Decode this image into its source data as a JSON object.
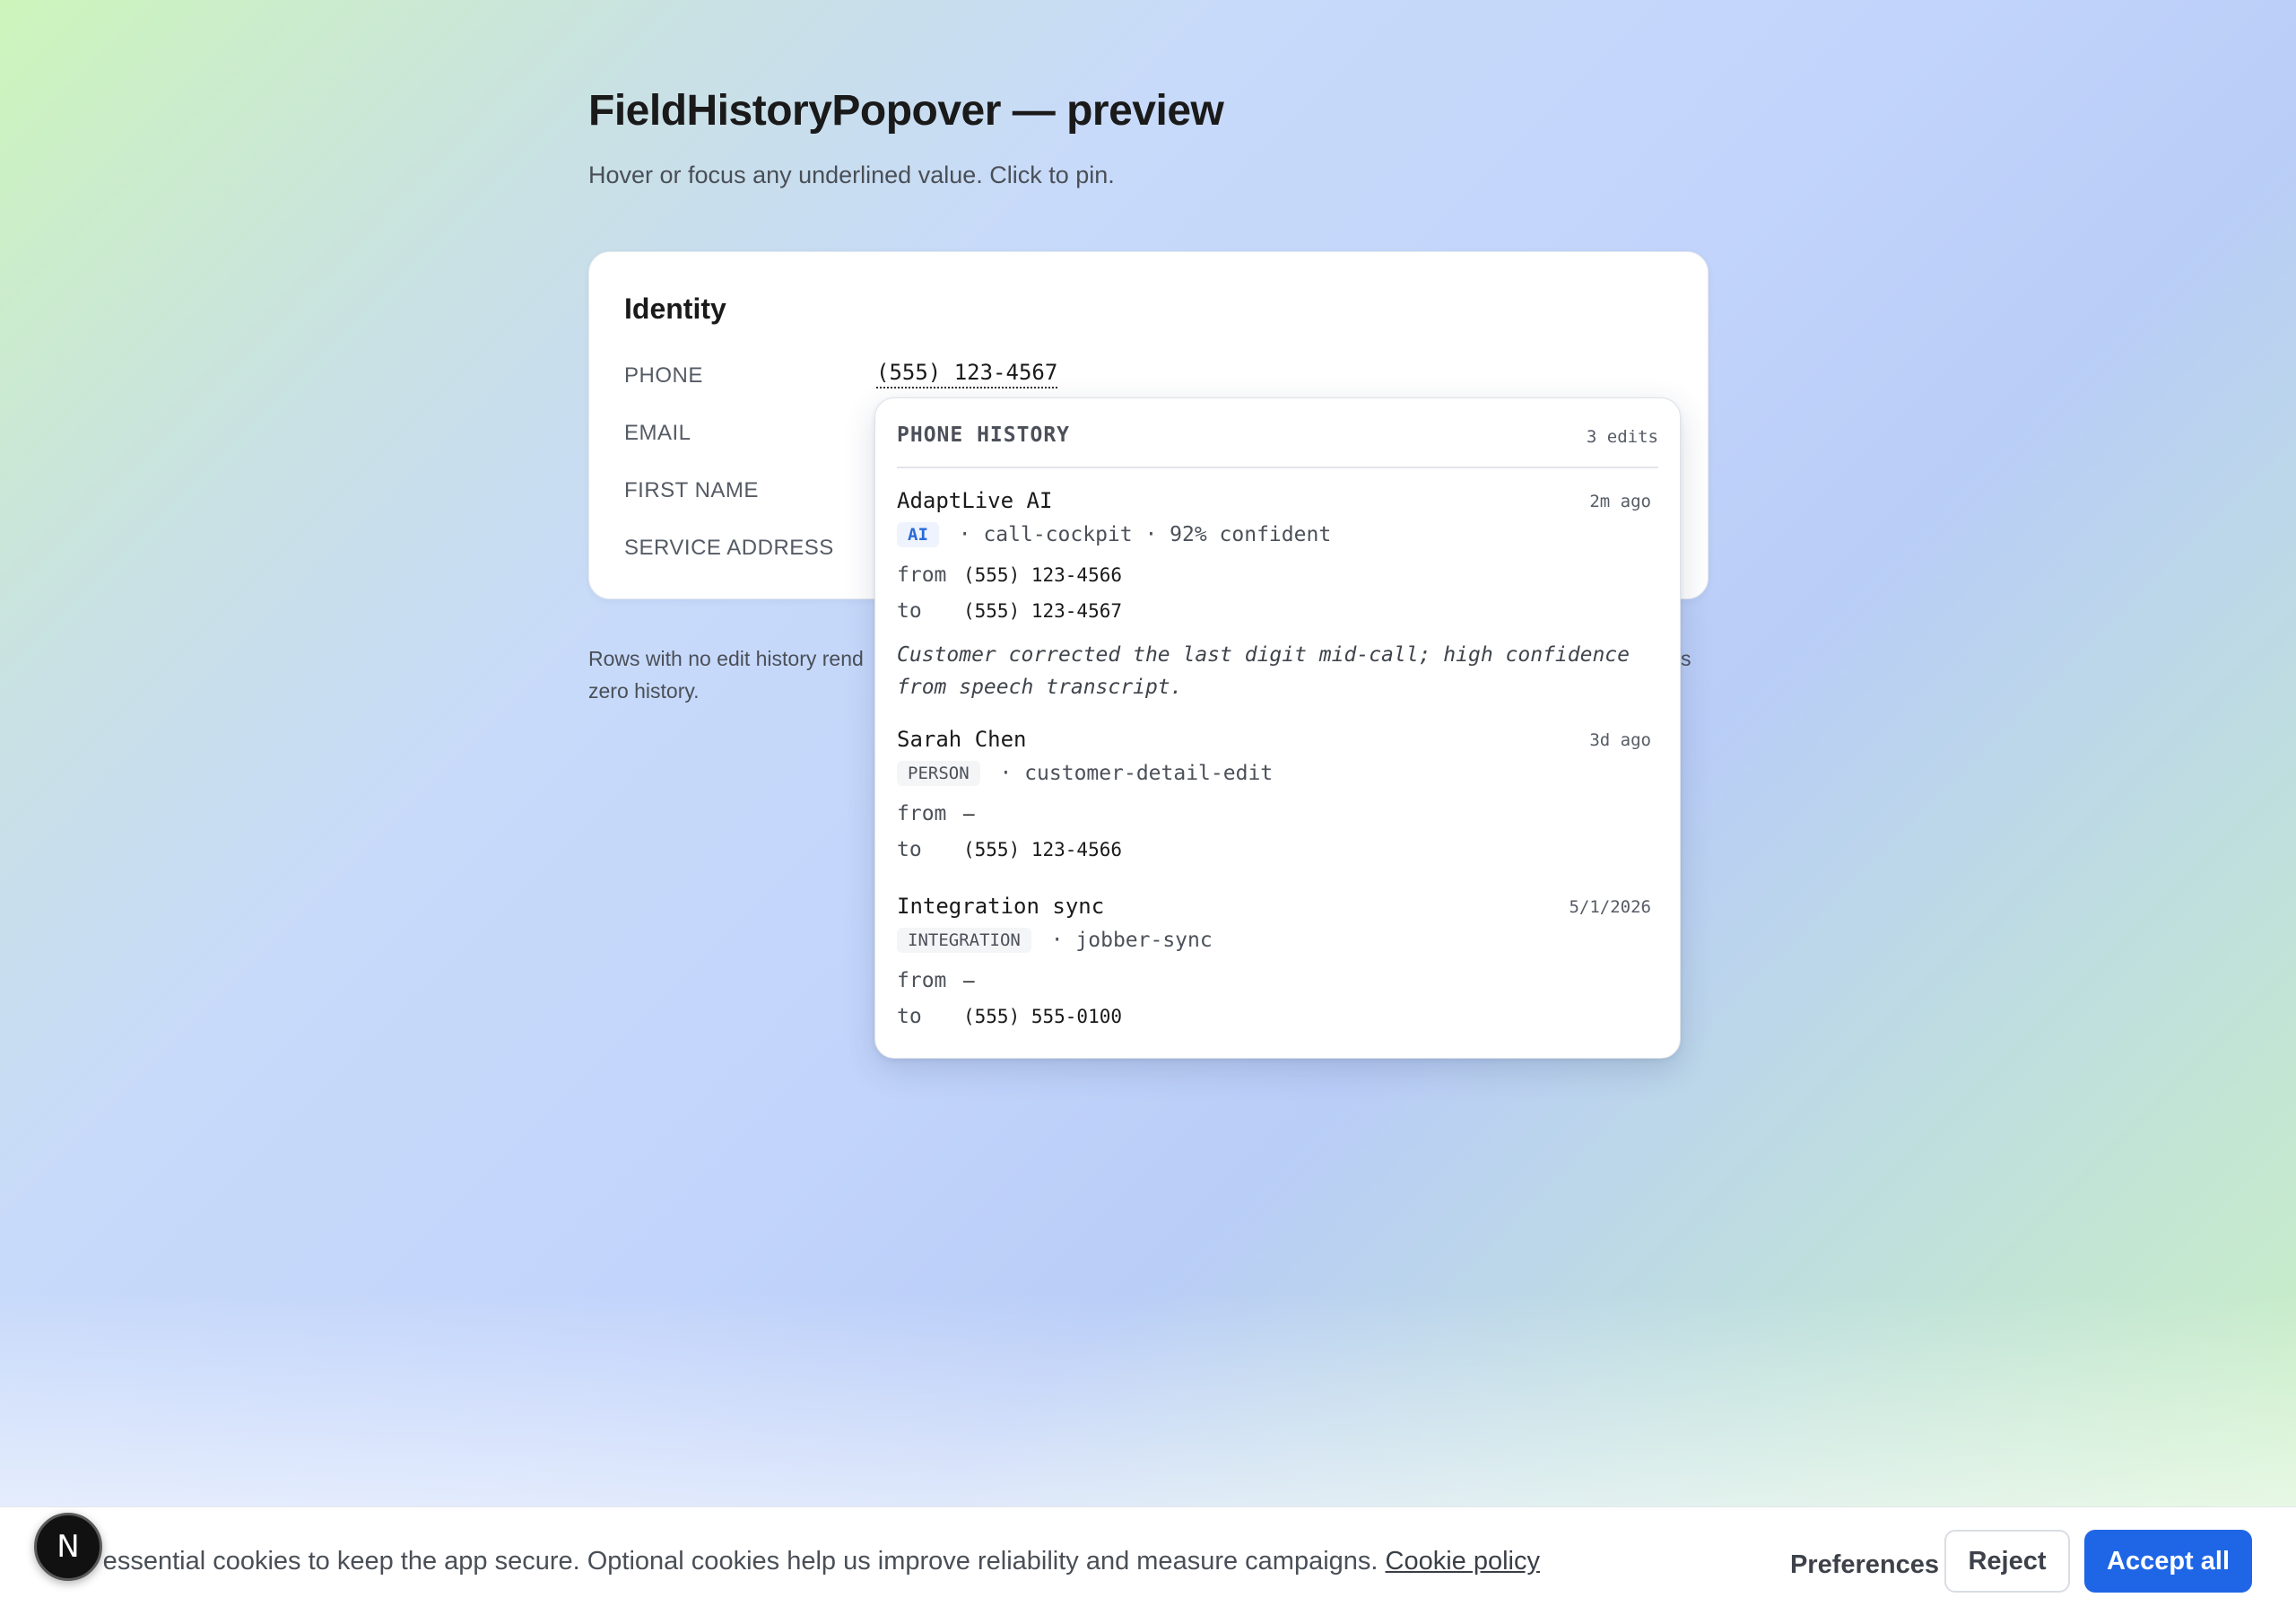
{
  "page": {
    "title": "FieldHistoryPopover — preview",
    "subtitle": "Hover or focus any underlined value. Click to pin."
  },
  "identity_card": {
    "title": "Identity",
    "fields": [
      {
        "label": "PHONE",
        "value": "(555) 123-4567"
      },
      {
        "label": "EMAIL"
      },
      {
        "label": "FIRST NAME"
      },
      {
        "label": "SERVICE ADDRESS"
      }
    ]
  },
  "note": {
    "left": "Rows with no edit history rend",
    "right": "s",
    "line2": "zero history."
  },
  "popover": {
    "title": "PHONE HISTORY",
    "count": "3 edits",
    "entries": [
      {
        "actor": "AdaptLive AI",
        "time": "2m ago",
        "tag": "AI",
        "meta": "· call-cockpit · 92% confident",
        "from_label": "from",
        "from": "(555) 123-4566",
        "to_label": "to",
        "to": "(555) 123-4567",
        "note": "Customer corrected the last digit mid-call; high confidence from speech transcript."
      },
      {
        "actor": "Sarah Chen",
        "time": "3d ago",
        "tag": "PERSON",
        "meta": "· customer-detail-edit",
        "from_label": "from",
        "from": "—",
        "to_label": "to",
        "to": "(555) 123-4566"
      },
      {
        "actor": "Integration sync",
        "time": "5/1/2026",
        "tag": "INTEGRATION",
        "meta": "· jobber-sync",
        "from_label": "from",
        "from": "—",
        "to_label": "to",
        "to": "(555) 555-0100"
      }
    ]
  },
  "cookie_banner": {
    "text": "se essential cookies to keep the app secure. Optional cookies help us improve reliability and measure campaigns.",
    "link": "Cookie policy",
    "preferences": "Preferences",
    "reject": "Reject",
    "accept": "Accept all"
  },
  "dev_badge": {
    "label": "N",
    "icon": "nextjs-logo-icon"
  },
  "colors": {
    "accent": "#1f66e6",
    "ai_tag": "#2a6ad8"
  }
}
